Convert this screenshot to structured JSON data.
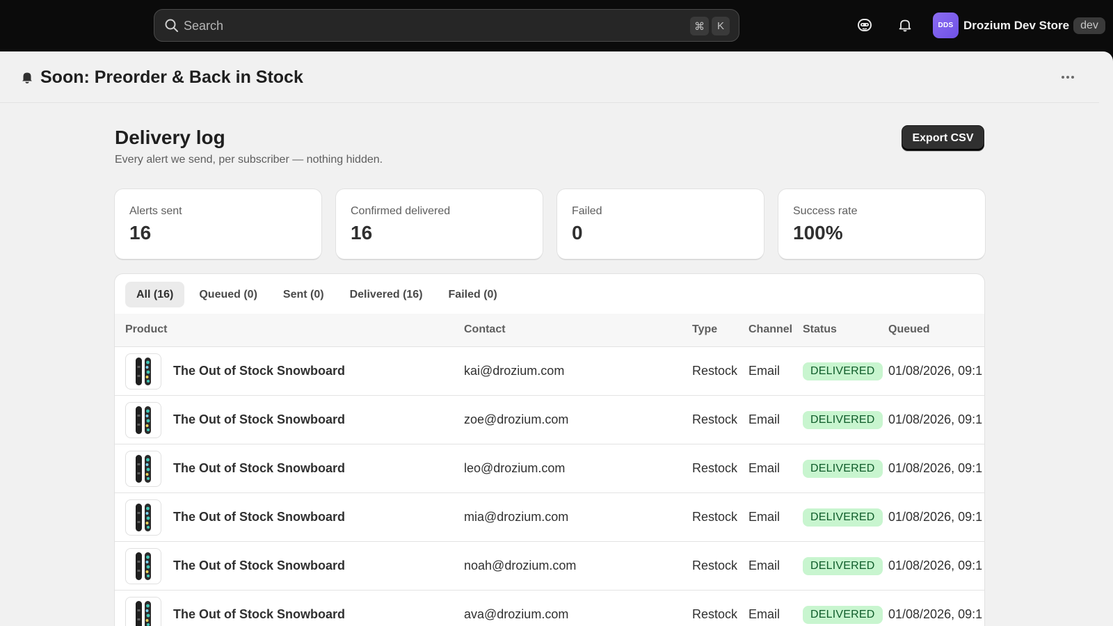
{
  "topbar": {
    "search_placeholder": "Search",
    "shortcut_cmd": "⌘",
    "shortcut_key": "K",
    "store_initials": "DDS",
    "store_name": "Drozium Dev Store",
    "store_badge": "dev"
  },
  "app": {
    "title": "Soon: Preorder & Back in Stock"
  },
  "page": {
    "title": "Delivery log",
    "subtitle": "Every alert we send, per subscriber — nothing hidden.",
    "export_label": "Export CSV"
  },
  "stats": [
    {
      "label": "Alerts sent",
      "value": "16"
    },
    {
      "label": "Confirmed delivered",
      "value": "16"
    },
    {
      "label": "Failed",
      "value": "0"
    },
    {
      "label": "Success rate",
      "value": "100%"
    }
  ],
  "tabs": [
    {
      "label": "All (16)",
      "active": true
    },
    {
      "label": "Queued (0)",
      "active": false
    },
    {
      "label": "Sent (0)",
      "active": false
    },
    {
      "label": "Delivered (16)",
      "active": false
    },
    {
      "label": "Failed (0)",
      "active": false
    }
  ],
  "table": {
    "headers": {
      "product": "Product",
      "contact": "Contact",
      "type": "Type",
      "channel": "Channel",
      "status": "Status",
      "queued": "Queued"
    },
    "rows": [
      {
        "product": "The Out of Stock Snowboard",
        "contact": "kai@drozium.com",
        "type": "Restock",
        "channel": "Email",
        "status": "DELIVERED",
        "queued": "01/08/2026, 09:1"
      },
      {
        "product": "The Out of Stock Snowboard",
        "contact": "zoe@drozium.com",
        "type": "Restock",
        "channel": "Email",
        "status": "DELIVERED",
        "queued": "01/08/2026, 09:1"
      },
      {
        "product": "The Out of Stock Snowboard",
        "contact": "leo@drozium.com",
        "type": "Restock",
        "channel": "Email",
        "status": "DELIVERED",
        "queued": "01/08/2026, 09:1"
      },
      {
        "product": "The Out of Stock Snowboard",
        "contact": "mia@drozium.com",
        "type": "Restock",
        "channel": "Email",
        "status": "DELIVERED",
        "queued": "01/08/2026, 09:1"
      },
      {
        "product": "The Out of Stock Snowboard",
        "contact": "noah@drozium.com",
        "type": "Restock",
        "channel": "Email",
        "status": "DELIVERED",
        "queued": "01/08/2026, 09:1"
      },
      {
        "product": "The Out of Stock Snowboard",
        "contact": "ava@drozium.com",
        "type": "Restock",
        "channel": "Email",
        "status": "DELIVERED",
        "queued": "01/08/2026, 09:1"
      }
    ]
  },
  "colors": {
    "topbar_bg": "#0b0b0b",
    "page_bg": "#f1f1f1",
    "badge_success_bg": "#c8f5cf",
    "badge_success_text": "#0f5c2a",
    "avatar_purple": "#7a5cf0"
  },
  "icons": {
    "search": "search-icon",
    "assistant": "assistant-icon",
    "notifications": "bell-icon",
    "app": "bell-icon",
    "more": "more-horizontal-icon",
    "thumbnail": "snowboard-image"
  }
}
